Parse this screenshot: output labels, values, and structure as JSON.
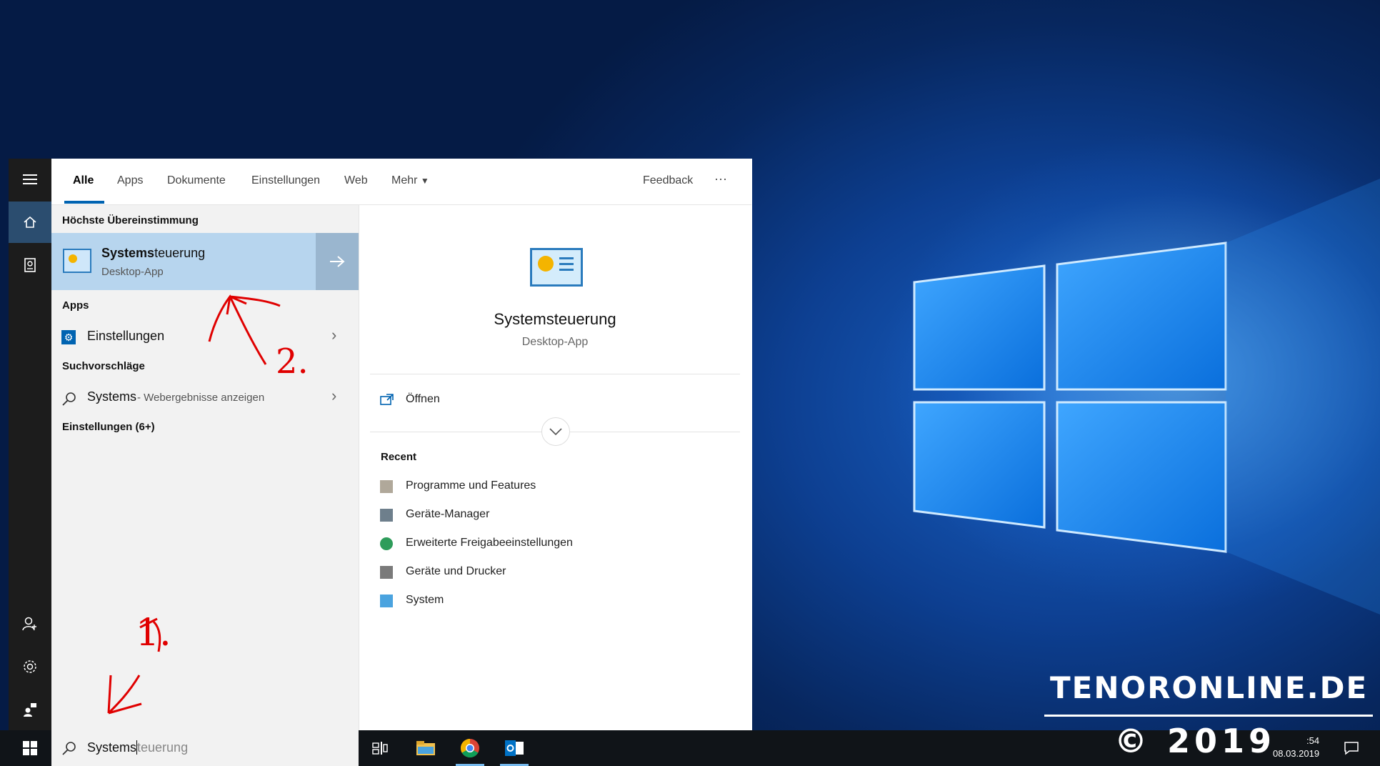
{
  "tabs": [
    {
      "label": "Alle"
    },
    {
      "label": "Apps"
    },
    {
      "label": "Dokumente"
    },
    {
      "label": "Einstellungen"
    },
    {
      "label": "Web"
    },
    {
      "label": "Mehr"
    }
  ],
  "feedback_label": "Feedback",
  "more_dots": "···",
  "left": {
    "best_match_header": "Höchste Übereinstimmung",
    "best_match": {
      "title_bold": "Systems",
      "title_rest": "teuerung",
      "subtitle": "Desktop-App"
    },
    "apps_header": "Apps",
    "app_item": "Einstellungen",
    "suggestions_header": "Suchvorschläge",
    "suggestion": {
      "term": "Systems",
      "hint": " - Webergebnisse anzeigen"
    },
    "settings_header": "Einstellungen (6+)"
  },
  "right": {
    "title": "Systemsteuerung",
    "subtitle": "Desktop-App",
    "open_label": "Öffnen",
    "recent_header": "Recent",
    "recent": [
      {
        "label": "Programme und Features"
      },
      {
        "label": "Geräte-Manager"
      },
      {
        "label": "Erweiterte Freigabeeinstellungen"
      },
      {
        "label": "Geräte und Drucker"
      },
      {
        "label": "System"
      }
    ]
  },
  "search": {
    "typed": "Systems",
    "suggest": "teuerung"
  },
  "clock": {
    "time": ":54",
    "date": "08.03.2019"
  },
  "annotations": {
    "one": "1.",
    "two": "2."
  },
  "watermark": {
    "site": "TENORONLINE.DE",
    "copy": "© 2019"
  },
  "colors": {
    "accent": "#0063b1",
    "selection": "#b7d5ee",
    "taskbar": "#101418"
  }
}
